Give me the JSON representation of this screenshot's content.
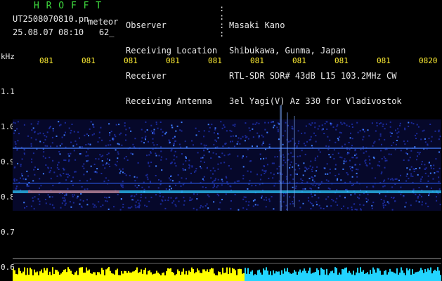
{
  "header": {
    "logo": "H R O F F T",
    "filename": "UT2508070810.pn",
    "meteor_label": "meteor",
    "stamp": "25.08.07 08:10   62_"
  },
  "meta": {
    "labels": [
      "Observer",
      "Receiving Location",
      "Receiver",
      "Receiving Antenna"
    ],
    "values": [
      "Masaki Kano",
      "Shibukawa, Gunma, Japan",
      "RTL-SDR SDR# 43dB L15 103.2MHz CW",
      "3el Yagi(V) Az 330 for Vladivostok"
    ]
  },
  "axis": {
    "y_unit": "kHz",
    "y_ticks": [
      "1.1",
      "1.0",
      "0.9",
      "0.8",
      "0.7",
      "0.6"
    ],
    "x_ticks": [
      "081",
      "081",
      "081",
      "081",
      "081",
      "081",
      "081",
      "081",
      "081",
      "0820"
    ]
  },
  "colors": {
    "logo": "#3fdc3f",
    "tick": "#ffee33",
    "noise": "#1a2a9a",
    "signal": "#2ec8ff",
    "bar_left": "#ffff00",
    "bar_right": "#22d4ff"
  }
}
